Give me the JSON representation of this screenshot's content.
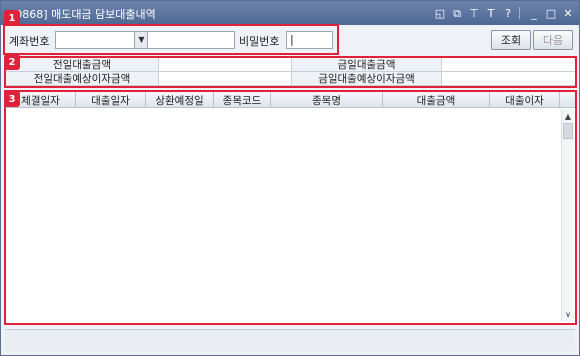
{
  "window": {
    "title": "[0868] 매도대금 담보대출내역"
  },
  "title_icons": [
    "window-restore-icon",
    "window-link-icon",
    "pin-icon",
    "font-size-icon",
    "help-icon",
    "minimize-icon",
    "maximize-icon",
    "close-icon"
  ],
  "title_icon_glyphs": {
    "window_restore": "◱",
    "window_link": "⧉",
    "pin": "⊤",
    "font": "T",
    "help": "?",
    "minimize": "_",
    "maximize": "□",
    "close": "✕"
  },
  "markers": [
    "1",
    "2",
    "3"
  ],
  "account": {
    "label": "계좌번호",
    "account_value": "",
    "account_name_value": "",
    "password_label": "비밀번호",
    "password_value": "|",
    "dropdown_glyph": "▼"
  },
  "buttons": {
    "search": "조회",
    "next": "다음"
  },
  "summary": {
    "prev_day_loan_label": "전일대출금액",
    "today_loan_label": "금일대출금액",
    "prev_day_interest_label": "전일대출예상이자금액",
    "today_interest_label": "금일대출예상이자금액",
    "prev_day_loan_value": "",
    "today_loan_value": "",
    "prev_day_interest_value": "",
    "today_interest_value": ""
  },
  "table": {
    "columns": [
      "체결일자",
      "대출일자",
      "상환예정일",
      "종목코드",
      "종목명",
      "대출금액",
      "대출이자"
    ],
    "rows": []
  },
  "scrollbar": {
    "up_glyph": "▲",
    "down_glyph": "∨"
  },
  "colors": {
    "titlebar": "#5a73a0",
    "highlight": "#e0213a",
    "panel": "#eef1f6"
  }
}
